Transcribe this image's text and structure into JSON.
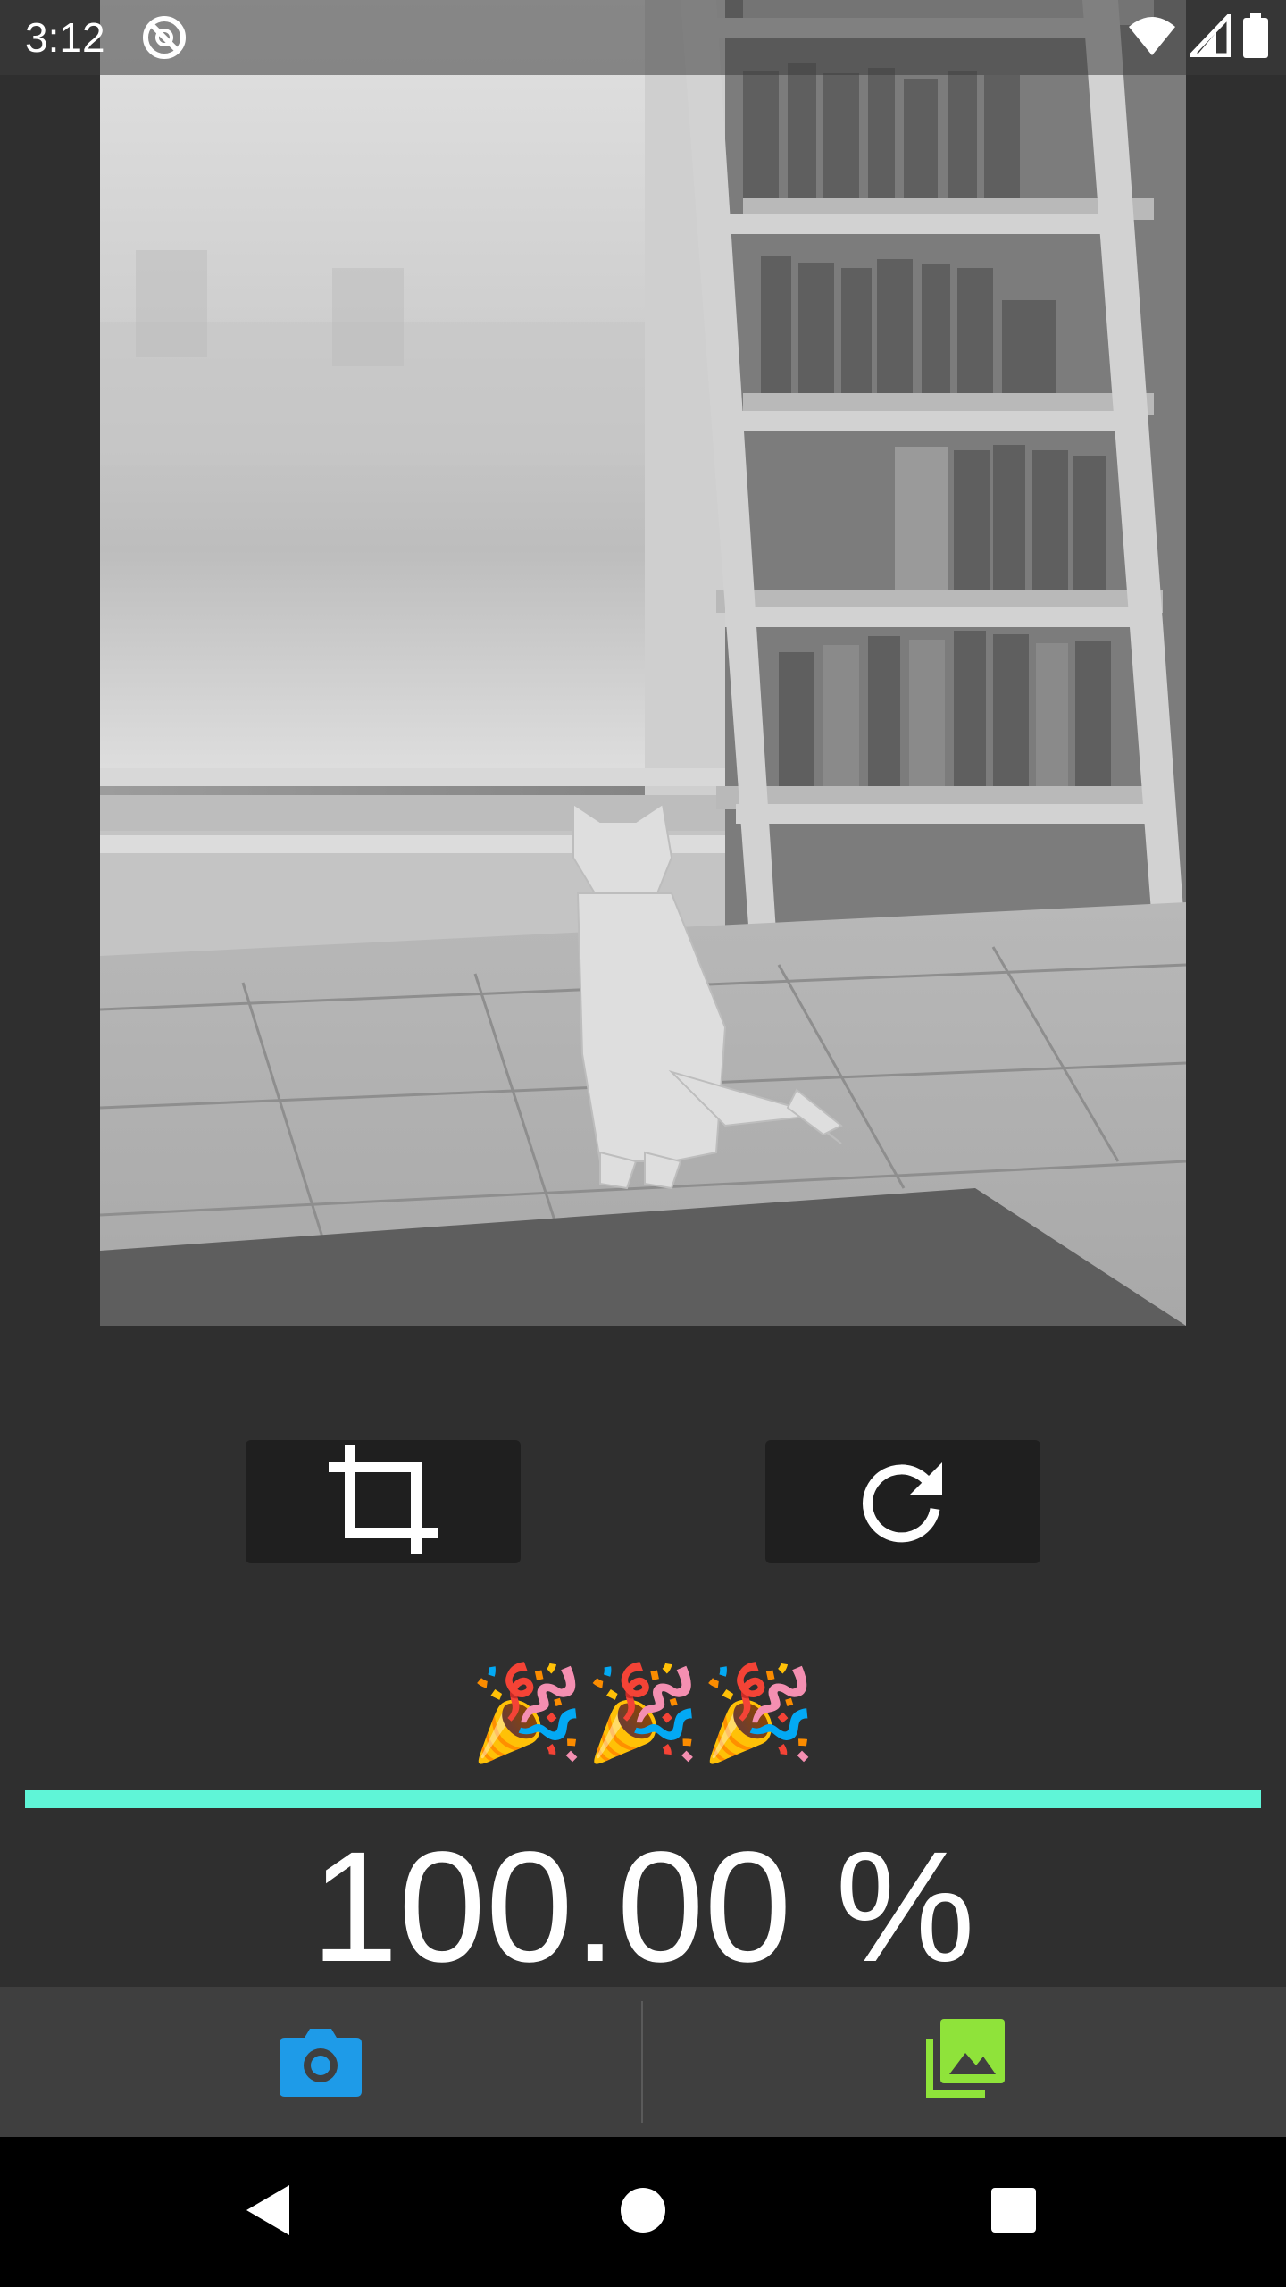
{
  "status_bar": {
    "time": "3:12",
    "icons": [
      "no-disturb-icon",
      "wifi-icon",
      "signal-icon",
      "battery-icon"
    ]
  },
  "photo": {
    "description_icon": "photo-preview"
  },
  "edit_buttons": {
    "crop_icon": "crop-icon",
    "rotate_icon": "rotate-icon"
  },
  "celebration": {
    "emoji": "🎉🎉🎉"
  },
  "progress": {
    "value": 1.0,
    "label": "100.00 %",
    "color": "#5ff5d7"
  },
  "action_bar": {
    "camera_icon": "camera-icon",
    "camera_color": "#1e9be8",
    "gallery_icon": "gallery-icon",
    "gallery_color": "#8fe33a"
  },
  "nav_bar": {
    "icons": [
      "back-icon",
      "home-icon",
      "recents-icon"
    ]
  }
}
